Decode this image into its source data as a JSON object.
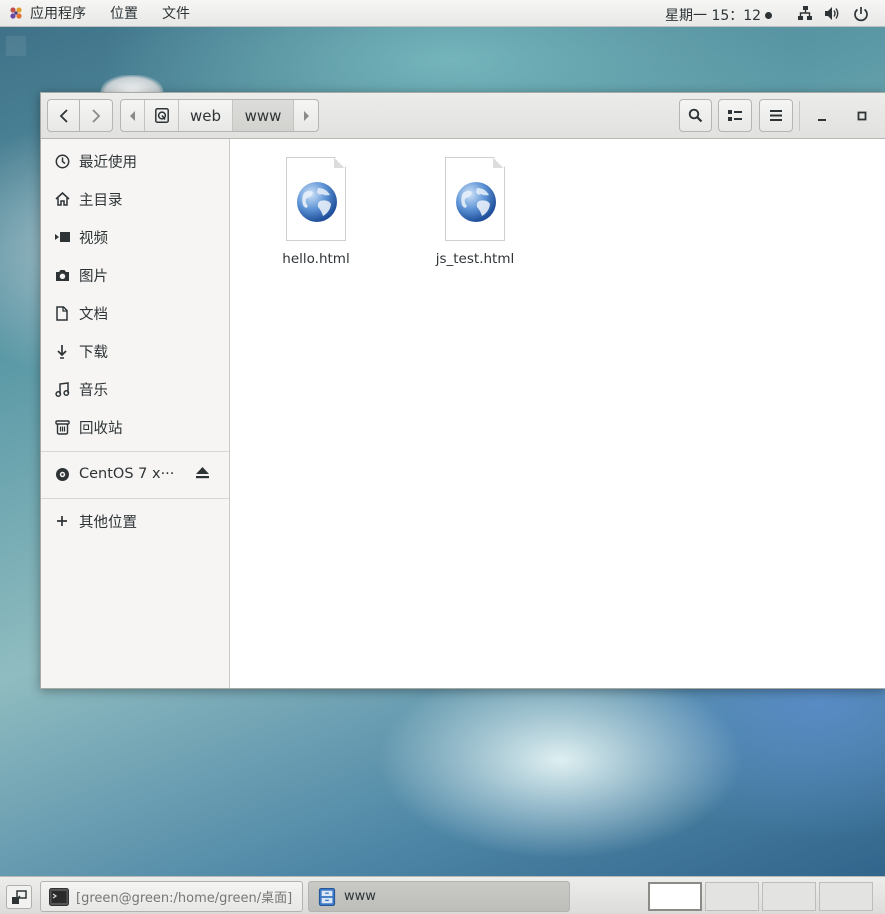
{
  "topbar": {
    "applications": "应用程序",
    "places": "位置",
    "files": "文件",
    "clock": "星期一 15：12",
    "icons": [
      "applications-icon",
      "network-icon",
      "volume-icon",
      "power-icon"
    ]
  },
  "window": {
    "path": {
      "segments": [
        "web",
        "www"
      ],
      "current": "www"
    },
    "icons": [
      "back-icon",
      "forward-icon",
      "search-icon",
      "view-options-icon",
      "menu-icon",
      "minimize-icon",
      "maximize-icon"
    ]
  },
  "sidebar": {
    "items": [
      {
        "label": "最近使用",
        "icon": "recent-clock-icon"
      },
      {
        "label": "主目录",
        "icon": "home-icon"
      },
      {
        "label": "视频",
        "icon": "video-icon"
      },
      {
        "label": "图片",
        "icon": "camera-icon"
      },
      {
        "label": "文档",
        "icon": "document-icon"
      },
      {
        "label": "下载",
        "icon": "download-icon"
      },
      {
        "label": "音乐",
        "icon": "music-icon"
      },
      {
        "label": "回收站",
        "icon": "trash-icon"
      }
    ],
    "device": {
      "label": "CentOS 7 x···",
      "icon": "disc-icon"
    },
    "other": {
      "label": "其他位置",
      "icon": "plus-icon"
    }
  },
  "content": {
    "files": [
      {
        "name": "hello.html",
        "icon": "html-globe-icon"
      },
      {
        "name": "js_test.html",
        "icon": "html-globe-icon"
      }
    ]
  },
  "taskbar": {
    "terminal_task": "[green@green:/home/green/桌面]",
    "files_task": "www",
    "workspaces": 4,
    "active_workspace": 1
  },
  "colors": {
    "accent_blue": "#3a77c4",
    "topbar_bg": "#ededec",
    "sidebar_bg": "#f6f5f4"
  }
}
